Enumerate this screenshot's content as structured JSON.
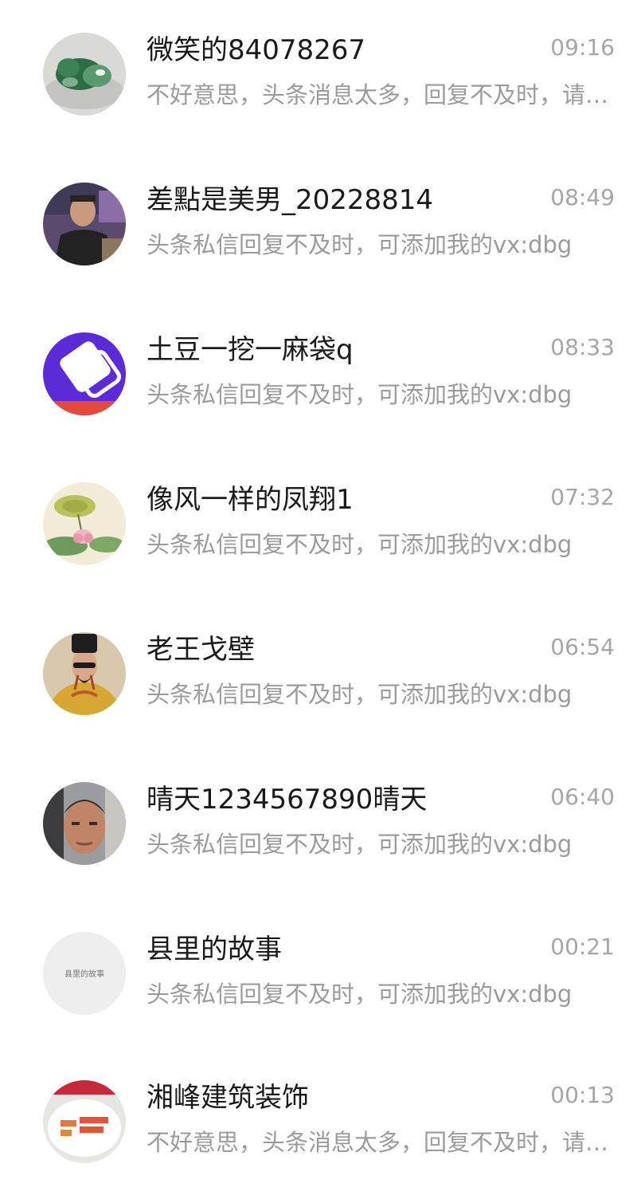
{
  "conversations": [
    {
      "name": "微笑的84078267",
      "time": "09:16",
      "preview": "不好意思，头条消息太多，回复不及时，请加我的vx沟通",
      "avatar": "jade-carving-avatar"
    },
    {
      "name": "差點是美男_20228814",
      "time": "08:49",
      "preview": "头条私信回复不及时，可添加我的vx:dbg",
      "avatar": "man-photo-avatar"
    },
    {
      "name": "土豆一挖一麻袋q",
      "time": "08:33",
      "preview": "头条私信回复不及时，可添加我的vx:dbg",
      "avatar": "purple-card-avatar"
    },
    {
      "name": "像风一样的凤翔1",
      "time": "07:32",
      "preview": "头条私信回复不及时，可添加我的vx:dbg",
      "avatar": "lotus-painting-avatar"
    },
    {
      "name": "老王戈壁",
      "time": "06:54",
      "preview": "头条私信回复不及时，可添加我的vx:dbg",
      "avatar": "emperor-costume-avatar"
    },
    {
      "name": "晴天1234567890晴天",
      "time": "06:40",
      "preview": "头条私信回复不及时，可添加我的vx:dbg",
      "avatar": "selfie-avatar"
    },
    {
      "name": "县里的故事",
      "time": "00:21",
      "preview": "头条私信回复不及时，可添加我的vx:dbg",
      "avatar": "text-avatar",
      "avatar_text": "县里的故事"
    },
    {
      "name": "湘峰建筑装饰",
      "time": "00:13",
      "preview": "不好意思，头条消息太多，回复不及时，请加我的vx沟通",
      "avatar": "sign-photo-avatar"
    }
  ]
}
